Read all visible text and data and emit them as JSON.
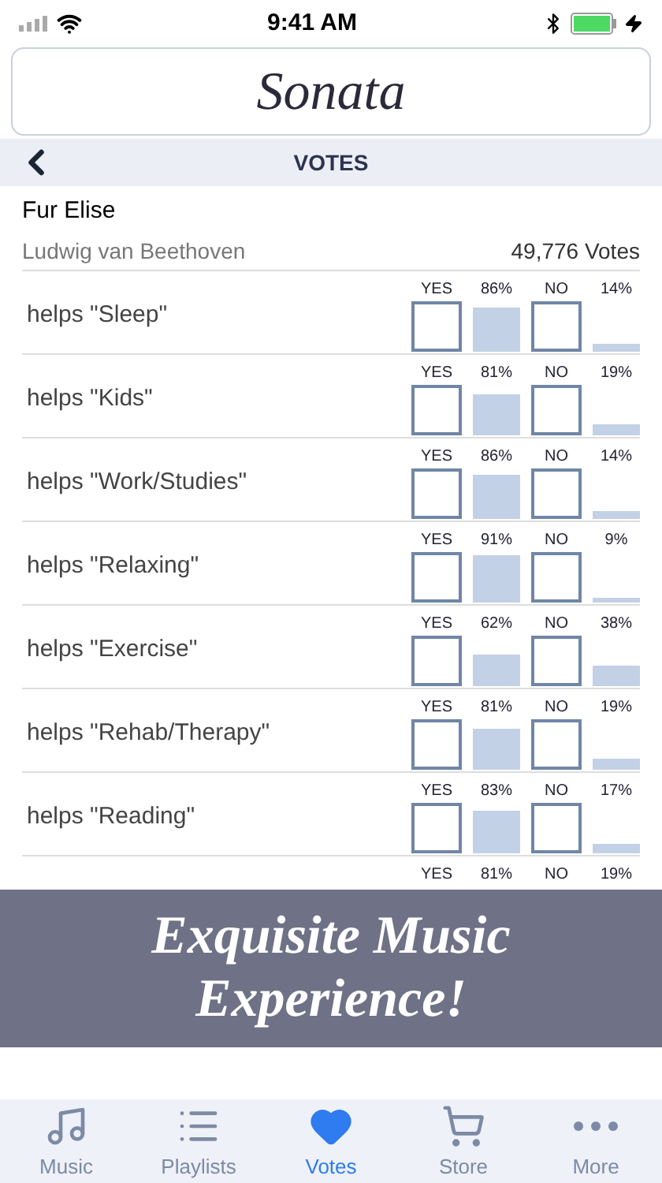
{
  "status_bar": {
    "time": "9:41 AM"
  },
  "logo": {
    "text": "Sonata"
  },
  "nav": {
    "title": "VOTES"
  },
  "song": {
    "title": "Fur Elise",
    "composer": "Ludwig van Beethoven",
    "votes": "49,776 Votes"
  },
  "rows": [
    {
      "label": "helps \"Sleep\"",
      "yes": {
        "label": "YES",
        "pct": "86%",
        "checked": false
      },
      "no": {
        "label": "NO",
        "pct": "14%",
        "checked": false
      }
    },
    {
      "label": "helps \"Kids\"",
      "yes": {
        "label": "YES",
        "pct": "81%",
        "checked": false
      },
      "no": {
        "label": "NO",
        "pct": "19%",
        "checked": false
      }
    },
    {
      "label": "helps \"Work/Studies\"",
      "yes": {
        "label": "YES",
        "pct": "86%",
        "checked": false
      },
      "no": {
        "label": "NO",
        "pct": "14%",
        "checked": false
      }
    },
    {
      "label": "helps \"Relaxing\"",
      "yes": {
        "label": "YES",
        "pct": "91%",
        "checked": false
      },
      "no": {
        "label": "NO",
        "pct": "9%",
        "checked": false
      }
    },
    {
      "label": "helps \"Exercise\"",
      "yes": {
        "label": "YES",
        "pct": "62%",
        "checked": false
      },
      "no": {
        "label": "NO",
        "pct": "38%",
        "checked": false
      }
    },
    {
      "label": "helps \"Rehab/Therapy\"",
      "yes": {
        "label": "YES",
        "pct": "81%",
        "checked": false
      },
      "no": {
        "label": "NO",
        "pct": "19%",
        "checked": false
      }
    },
    {
      "label": "helps \"Reading\"",
      "yes": {
        "label": "YES",
        "pct": "83%",
        "checked": false
      },
      "no": {
        "label": "NO",
        "pct": "17%",
        "checked": false
      }
    },
    {
      "yes": {
        "label": "YES",
        "pct": "81%"
      },
      "no": {
        "label": "NO",
        "pct": "19%"
      }
    }
  ],
  "banner": {
    "lines": [
      "Exquisite Music",
      "Experience!"
    ]
  },
  "tabs": [
    {
      "kind": "music",
      "label": "Music",
      "selected": false
    },
    {
      "kind": "playlists",
      "label": "Playlists",
      "selected": false
    },
    {
      "kind": "votes",
      "label": "Votes",
      "selected": true
    },
    {
      "kind": "store",
      "label": "Store",
      "selected": false
    },
    {
      "kind": "more",
      "label": "More",
      "selected": false
    }
  ]
}
